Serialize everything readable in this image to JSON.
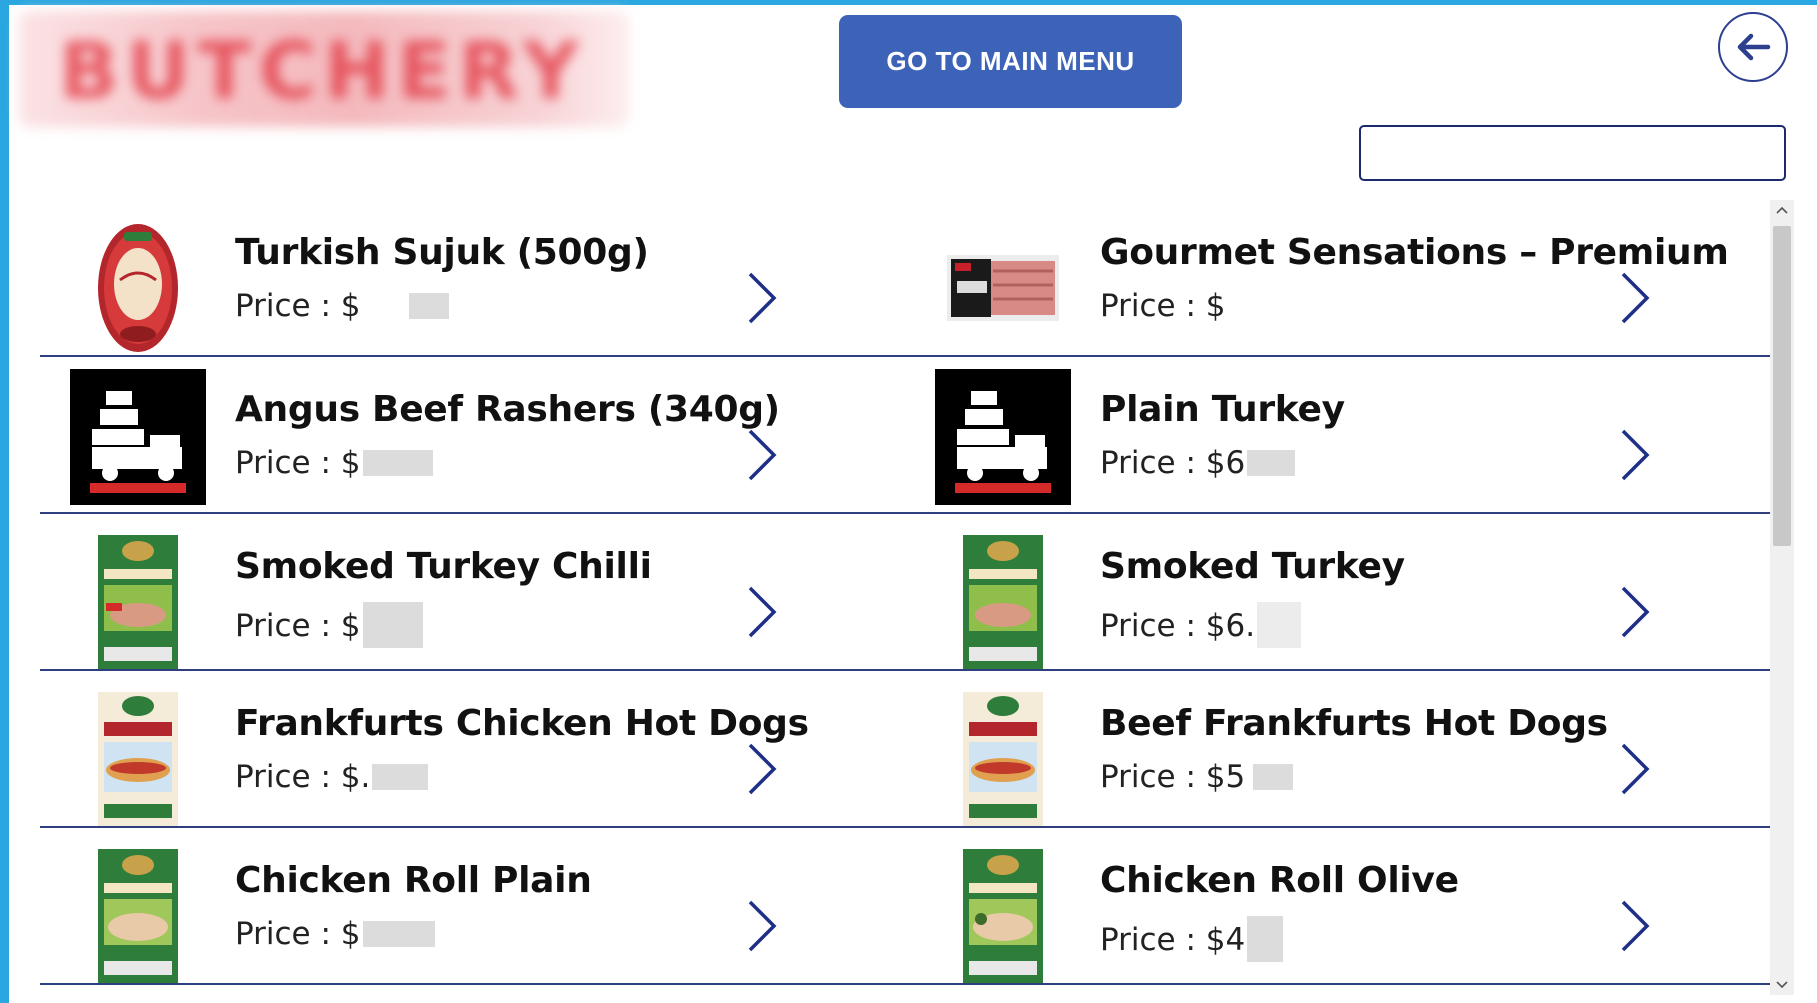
{
  "header": {
    "logo_text": "BUTCHERY",
    "main_menu_label": "GO TO MAIN MENU",
    "back_icon": "arrow-left-icon"
  },
  "search": {
    "value": "",
    "placeholder": ""
  },
  "colors": {
    "frame": "#2aa7e0",
    "button": "#3d63b8",
    "divider": "#2e3f80",
    "chevron": "#1d2f86"
  },
  "products": [
    [
      {
        "title": "Turkish Sujuk (500g)",
        "price": "Price : $",
        "image": "sujuk-package-icon"
      },
      {
        "title": "Gourmet Sensations – Premium",
        "price": "Price : $",
        "image": "turkey-bacon-package-icon"
      }
    ],
    [
      {
        "title": "Angus Beef Rashers (340g)",
        "price": "Price : $",
        "image": "butchery-logo-icon"
      },
      {
        "title": "Plain Turkey",
        "price": "Price : $6",
        "image": "butchery-logo-icon"
      }
    ],
    [
      {
        "title": "Smoked Turkey Chilli",
        "price": "Price : $",
        "image": "smoked-turkey-package-icon"
      },
      {
        "title": "Smoked Turkey",
        "price": "Price : $6.",
        "image": "smoked-turkey-package-icon"
      }
    ],
    [
      {
        "title": "Frankfurts Chicken Hot Dogs",
        "price": "Price : $.",
        "image": "frankfurts-package-icon"
      },
      {
        "title": "Beef Frankfurts Hot Dogs",
        "price": "Price : $5",
        "image": "frankfurts-package-icon"
      }
    ],
    [
      {
        "title": "Chicken Roll Plain",
        "price": "Price : $",
        "image": "chicken-roll-package-icon"
      },
      {
        "title": "Chicken Roll Olive",
        "price": "Price : $4",
        "image": "chicken-roll-package-icon"
      }
    ]
  ]
}
